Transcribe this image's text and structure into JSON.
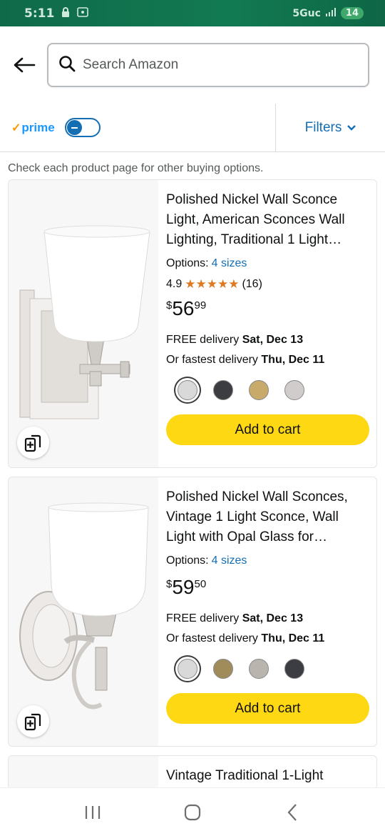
{
  "status_bar": {
    "time": "5:11",
    "network": "5Guc",
    "battery": "14"
  },
  "search": {
    "placeholder": "Search Amazon"
  },
  "filter_bar": {
    "prime_label": "prime",
    "filters_label": "Filters"
  },
  "note": "Check each product page for other buying options.",
  "products": [
    {
      "title": "Polished Nickel Wall Sconce Light, American Sconces Wall Lighting, Traditional 1 Light…",
      "options_label": "Options:",
      "options_value": "4 sizes",
      "rating": "4.9",
      "stars": "★★★★★",
      "reviews": "(16)",
      "price_symbol": "$",
      "price_whole": "56",
      "price_fraction": "99",
      "delivery_prefix": "FREE delivery",
      "delivery_date": "Sat, Dec 13",
      "fastest_prefix": "Or fastest delivery",
      "fastest_date": "Thu, Dec 11",
      "swatch_colors": [
        "#d9d9d9",
        "#3b3d40",
        "#c8aa6a",
        "#cfcccb"
      ],
      "add_to_cart": "Add to cart"
    },
    {
      "title": "Polished Nickel Wall Sconces, Vintage 1 Light Sconce, Wall Light with Opal Glass for…",
      "options_label": "Options:",
      "options_value": "4 sizes",
      "price_symbol": "$",
      "price_whole": "59",
      "price_fraction": "50",
      "delivery_prefix": "FREE delivery",
      "delivery_date": "Sat, Dec 13",
      "fastest_prefix": "Or fastest delivery",
      "fastest_date": "Thu, Dec 11",
      "swatch_colors": [
        "#d9d9d9",
        "#a08c5a",
        "#b9b4ae",
        "#3b3d42"
      ],
      "add_to_cart": "Add to cart"
    },
    {
      "title": "Vintage Traditional 1-Light"
    }
  ],
  "colors": {
    "accent": "#146eb4",
    "cart_button": "#ffd814",
    "star": "#de7921"
  }
}
